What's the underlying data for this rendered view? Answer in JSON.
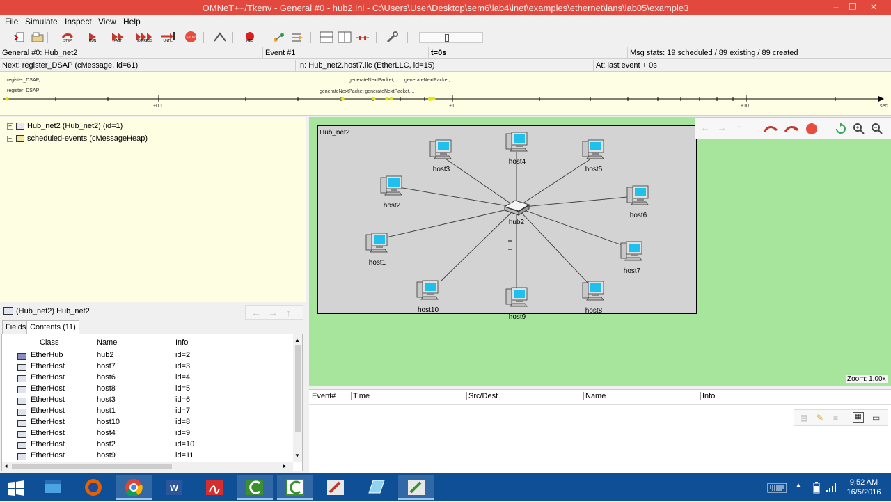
{
  "window": {
    "title": "OMNeT++/Tkenv - General #0 - hub2.ini - C:\\Users\\User\\Desktop\\sem6\\lab4\\inet\\examples\\ethernet\\lans\\lab05\\example3",
    "minimize": "–",
    "restore": "❐",
    "close": "✕"
  },
  "menu": [
    "File",
    "Simulate",
    "Inspect",
    "View",
    "Help"
  ],
  "toolbar": {
    "step": "STEP",
    "run": "RUN",
    "fast": "FAST",
    "express": "EXPRESS",
    "until": "UNTIL",
    "stop": "STOP",
    "rec": "REC"
  },
  "status1": {
    "run": "General #0: Hub_net2",
    "event": "Event #1",
    "time": "t=0s",
    "msgstats": "Msg stats: 19 scheduled / 89 existing / 89 created"
  },
  "status2": {
    "next": "Next: register_DSAP (cMessage, id=61)",
    "in": "In: Hub_net2.host7.llc (EtherLLC, id=15)",
    "at": "At: last event + 0s"
  },
  "timeline": {
    "events": [
      "register_DSAP,...",
      "register_DSAP",
      "generateNextPacket,...",
      "generateNextPacket,...",
      "generateNextPacket generateNextPacket,..."
    ],
    "ticks": [
      "+0.1",
      "+1",
      "+10",
      "sec"
    ]
  },
  "tree": [
    {
      "label": "Hub_net2 (Hub_net2) (id=1)"
    },
    {
      "label": "scheduled-events (cMessageHeap)"
    }
  ],
  "inspector": {
    "title": "(Hub_net2) Hub_net2",
    "tabs": [
      "Fields",
      "Contents (11)"
    ],
    "columns": [
      "Class",
      "Name",
      "Info"
    ],
    "rows": [
      {
        "class": "EtherHub",
        "name": "hub2",
        "info": "id=2"
      },
      {
        "class": "EtherHost",
        "name": "host7",
        "info": "id=3"
      },
      {
        "class": "EtherHost",
        "name": "host6",
        "info": "id=4"
      },
      {
        "class": "EtherHost",
        "name": "host8",
        "info": "id=5"
      },
      {
        "class": "EtherHost",
        "name": "host3",
        "info": "id=6"
      },
      {
        "class": "EtherHost",
        "name": "host1",
        "info": "id=7"
      },
      {
        "class": "EtherHost",
        "name": "host10",
        "info": "id=8"
      },
      {
        "class": "EtherHost",
        "name": "host4",
        "info": "id=9"
      },
      {
        "class": "EtherHost",
        "name": "host2",
        "info": "id=10"
      },
      {
        "class": "EtherHost",
        "name": "host9",
        "info": "id=11"
      }
    ]
  },
  "network": {
    "name": "Hub_net2",
    "hub": "hub2",
    "hosts": [
      "host1",
      "host2",
      "host3",
      "host4",
      "host5",
      "host6",
      "host7",
      "host8",
      "host9",
      "host10"
    ]
  },
  "zoom": "Zoom: 1.00x",
  "eventlog": {
    "columns": [
      "Event#",
      "Time",
      "Src/Dest",
      "Name",
      "Info"
    ]
  },
  "clock": {
    "time": "9:52 AM",
    "date": "16/5/2016"
  },
  "colors": {
    "titlebar": "#e2483d",
    "canvas": "#a6e59b",
    "netbox": "#d3d3d3",
    "objtree": "#fefee2",
    "taskbar": "#0f4f96"
  }
}
